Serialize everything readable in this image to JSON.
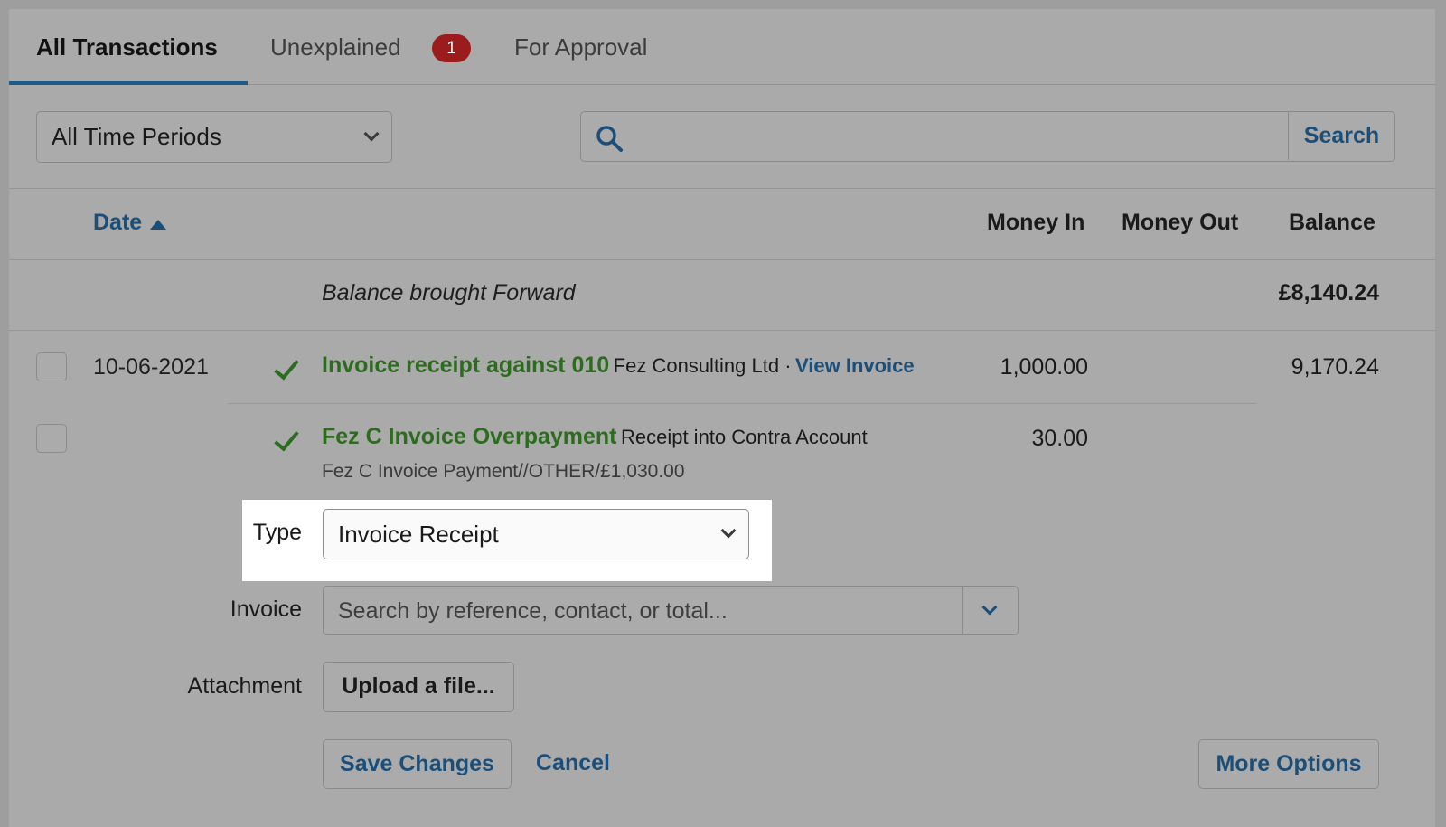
{
  "tabs": [
    {
      "label": "All Transactions"
    },
    {
      "label": "Unexplained",
      "badge": "1"
    },
    {
      "label": "For Approval"
    }
  ],
  "filter": {
    "period": "All Time Periods",
    "search_placeholder": "",
    "search_button": "Search"
  },
  "table": {
    "headers": {
      "date": "Date",
      "money_in": "Money In",
      "money_out": "Money Out",
      "balance": "Balance"
    },
    "brought_forward": {
      "label": "Balance brought Forward",
      "balance": "£8,140.24"
    },
    "rows": [
      {
        "date": "10-06-2021",
        "title": "Invoice receipt against 010",
        "description": "Fez Consulting Ltd ·",
        "link": "View Invoice",
        "money_in": "1,000.00",
        "balance": "9,170.24"
      },
      {
        "title": "Fez C Invoice Overpayment",
        "description": "Receipt into Contra Account",
        "subtext": "Fez C Invoice Payment//OTHER/£1,030.00",
        "money_in": "30.00"
      }
    ]
  },
  "form": {
    "type_label": "Type",
    "type_value": "Invoice Receipt",
    "invoice_label": "Invoice",
    "invoice_placeholder": "Search by reference, contact, or total...",
    "attachment_label": "Attachment",
    "upload_button": "Upload a file...",
    "save_button": "Save Changes",
    "cancel_link": "Cancel",
    "more_options_button": "More Options"
  },
  "colors": {
    "accent": "#1b4f79",
    "success": "#2d6c1e",
    "badge": "#9b1c1c",
    "overlay_bg": "#aaaaaa",
    "highlight": "#ffffff"
  }
}
